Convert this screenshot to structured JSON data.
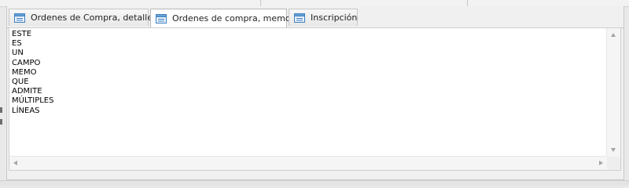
{
  "tabs": [
    {
      "label": "Ordenes de Compra, detalle",
      "active": false,
      "icon": "form-icon"
    },
    {
      "label": "Ordenes de compra, memo",
      "active": true,
      "icon": "form-icon"
    },
    {
      "label": "Inscripción",
      "active": false,
      "icon": "form-icon"
    }
  ],
  "memo": {
    "lines": [
      "ESTE",
      "ES",
      "UN",
      "CAMPO",
      "MEMO",
      "QUE",
      "ADMITE",
      "MÚLTIPLES",
      "LÍNEAS"
    ]
  },
  "colors": {
    "icon_blue": "#3d7fbf",
    "panel_bg": "#f0f0f0",
    "tab_active_bg": "#ffffff"
  }
}
